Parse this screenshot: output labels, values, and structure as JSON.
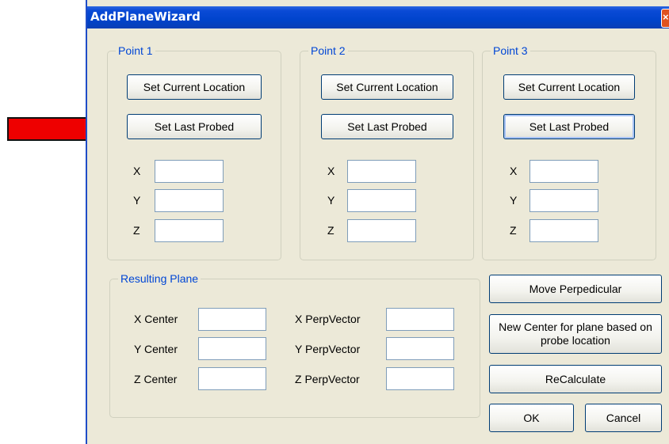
{
  "window": {
    "title": "AddPlaneWizard",
    "close_glyph": "×"
  },
  "points": [
    {
      "title": "Point 1",
      "set_current": "Set Current Location",
      "set_last": "Set Last Probed",
      "x_label": "X",
      "y_label": "Y",
      "z_label": "Z",
      "x_value": "",
      "y_value": "",
      "z_value": ""
    },
    {
      "title": "Point 2",
      "set_current": "Set Current Location",
      "set_last": "Set Last Probed",
      "x_label": "X",
      "y_label": "Y",
      "z_label": "Z",
      "x_value": "",
      "y_value": "",
      "z_value": ""
    },
    {
      "title": "Point 3",
      "set_current": "Set Current Location",
      "set_last": "Set Last Probed",
      "x_label": "X",
      "y_label": "Y",
      "z_label": "Z",
      "x_value": "",
      "y_value": "",
      "z_value": ""
    }
  ],
  "resulting_plane": {
    "title": "Resulting Plane",
    "x_center_label": "X Center",
    "y_center_label": "Y Center",
    "z_center_label": "Z Center",
    "x_perp_label": "X PerpVector",
    "y_perp_label": "Y PerpVector",
    "z_perp_label": "Z PerpVector",
    "x_center": "",
    "y_center": "",
    "z_center": "",
    "x_perp": "",
    "y_perp": "",
    "z_perp": ""
  },
  "actions": {
    "move_perpendicular": "Move Perpedicular",
    "new_center": "New Center for plane based on probe location",
    "recalculate": "ReCalculate",
    "ok": "OK",
    "cancel": "Cancel"
  },
  "annotation": {
    "arrow_icon": "red-arrow-icon",
    "color": "#ee0000"
  }
}
